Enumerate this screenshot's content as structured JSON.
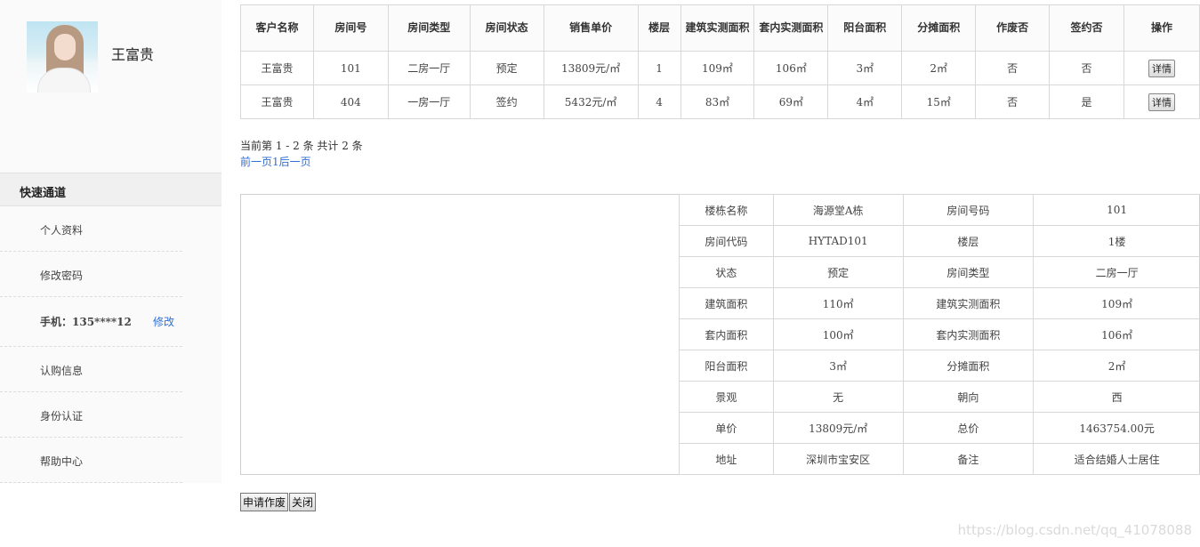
{
  "user": {
    "name": "王富贵"
  },
  "quick": {
    "title": "快速通道",
    "items": [
      {
        "label": "个人资料"
      },
      {
        "label": "修改密码"
      },
      {
        "label": "手机：135****12",
        "action": "修改"
      },
      {
        "label": "认购信息"
      },
      {
        "label": "身份认证"
      },
      {
        "label": "帮助中心"
      }
    ]
  },
  "room_table": {
    "headers": [
      "客户名称",
      "房间号",
      "房间类型",
      "房间状态",
      "销售单价",
      "楼层",
      "建筑实测面积",
      "套内实测面积",
      "阳台面积",
      "分摊面积",
      "作废否",
      "签约否",
      "操作"
    ],
    "rows": [
      [
        "王富贵",
        "101",
        "二房一厅",
        "预定",
        "13809元/㎡",
        "1",
        "109㎡",
        "106㎡",
        "3㎡",
        "2㎡",
        "否",
        "否",
        "详情"
      ],
      [
        "王富贵",
        "404",
        "一房一厅",
        "签约",
        "5432元/㎡",
        "4",
        "83㎡",
        "69㎡",
        "4㎡",
        "15㎡",
        "否",
        "是",
        "详情"
      ]
    ]
  },
  "pager": {
    "info": "当前第 1 - 2 条   共计 2 条",
    "prev": "前一页",
    "page": "1",
    "next": "后一页"
  },
  "detail": {
    "rows": [
      [
        "楼栋名称",
        "海源堂A栋",
        "房间号码",
        "101"
      ],
      [
        "房间代码",
        "HYTAD101",
        "楼层",
        "1楼"
      ],
      [
        "状态",
        "预定",
        "房间类型",
        "二房一厅"
      ],
      [
        "建筑面积",
        "110㎡",
        "建筑实测面积",
        "109㎡"
      ],
      [
        "套内面积",
        "100㎡",
        "套内实测面积",
        "106㎡"
      ],
      [
        "阳台面积",
        "3㎡",
        "分摊面积",
        "2㎡"
      ],
      [
        "景观",
        "无",
        "朝向",
        "西"
      ],
      [
        "单价",
        "13809元/㎡",
        "总价",
        "1463754.00元"
      ],
      [
        "地址",
        "深圳市宝安区",
        "备注",
        "适合结婚人士居住"
      ]
    ]
  },
  "actions": {
    "void": "申请作废",
    "close": "关闭"
  },
  "watermark": "https://blog.csdn.net/qq_41078088"
}
